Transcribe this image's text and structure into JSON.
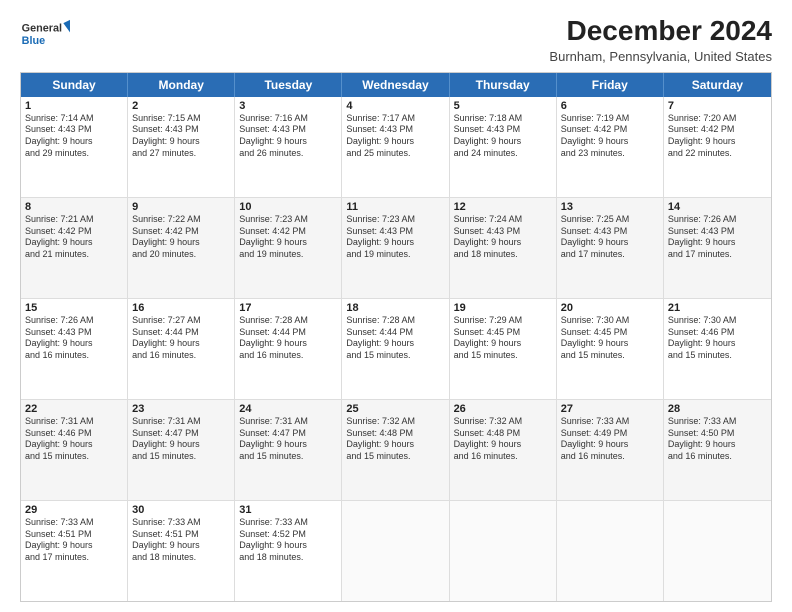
{
  "logo": {
    "line1": "General",
    "line2": "Blue"
  },
  "title": "December 2024",
  "subtitle": "Burnham, Pennsylvania, United States",
  "header_days": [
    "Sunday",
    "Monday",
    "Tuesday",
    "Wednesday",
    "Thursday",
    "Friday",
    "Saturday"
  ],
  "weeks": [
    [
      {
        "day": "1",
        "info": "Sunrise: 7:14 AM\nSunset: 4:43 PM\nDaylight: 9 hours\nand 29 minutes."
      },
      {
        "day": "2",
        "info": "Sunrise: 7:15 AM\nSunset: 4:43 PM\nDaylight: 9 hours\nand 27 minutes."
      },
      {
        "day": "3",
        "info": "Sunrise: 7:16 AM\nSunset: 4:43 PM\nDaylight: 9 hours\nand 26 minutes."
      },
      {
        "day": "4",
        "info": "Sunrise: 7:17 AM\nSunset: 4:43 PM\nDaylight: 9 hours\nand 25 minutes."
      },
      {
        "day": "5",
        "info": "Sunrise: 7:18 AM\nSunset: 4:43 PM\nDaylight: 9 hours\nand 24 minutes."
      },
      {
        "day": "6",
        "info": "Sunrise: 7:19 AM\nSunset: 4:42 PM\nDaylight: 9 hours\nand 23 minutes."
      },
      {
        "day": "7",
        "info": "Sunrise: 7:20 AM\nSunset: 4:42 PM\nDaylight: 9 hours\nand 22 minutes."
      }
    ],
    [
      {
        "day": "8",
        "info": "Sunrise: 7:21 AM\nSunset: 4:42 PM\nDaylight: 9 hours\nand 21 minutes."
      },
      {
        "day": "9",
        "info": "Sunrise: 7:22 AM\nSunset: 4:42 PM\nDaylight: 9 hours\nand 20 minutes."
      },
      {
        "day": "10",
        "info": "Sunrise: 7:23 AM\nSunset: 4:42 PM\nDaylight: 9 hours\nand 19 minutes."
      },
      {
        "day": "11",
        "info": "Sunrise: 7:23 AM\nSunset: 4:43 PM\nDaylight: 9 hours\nand 19 minutes."
      },
      {
        "day": "12",
        "info": "Sunrise: 7:24 AM\nSunset: 4:43 PM\nDaylight: 9 hours\nand 18 minutes."
      },
      {
        "day": "13",
        "info": "Sunrise: 7:25 AM\nSunset: 4:43 PM\nDaylight: 9 hours\nand 17 minutes."
      },
      {
        "day": "14",
        "info": "Sunrise: 7:26 AM\nSunset: 4:43 PM\nDaylight: 9 hours\nand 17 minutes."
      }
    ],
    [
      {
        "day": "15",
        "info": "Sunrise: 7:26 AM\nSunset: 4:43 PM\nDaylight: 9 hours\nand 16 minutes."
      },
      {
        "day": "16",
        "info": "Sunrise: 7:27 AM\nSunset: 4:44 PM\nDaylight: 9 hours\nand 16 minutes."
      },
      {
        "day": "17",
        "info": "Sunrise: 7:28 AM\nSunset: 4:44 PM\nDaylight: 9 hours\nand 16 minutes."
      },
      {
        "day": "18",
        "info": "Sunrise: 7:28 AM\nSunset: 4:44 PM\nDaylight: 9 hours\nand 15 minutes."
      },
      {
        "day": "19",
        "info": "Sunrise: 7:29 AM\nSunset: 4:45 PM\nDaylight: 9 hours\nand 15 minutes."
      },
      {
        "day": "20",
        "info": "Sunrise: 7:30 AM\nSunset: 4:45 PM\nDaylight: 9 hours\nand 15 minutes."
      },
      {
        "day": "21",
        "info": "Sunrise: 7:30 AM\nSunset: 4:46 PM\nDaylight: 9 hours\nand 15 minutes."
      }
    ],
    [
      {
        "day": "22",
        "info": "Sunrise: 7:31 AM\nSunset: 4:46 PM\nDaylight: 9 hours\nand 15 minutes."
      },
      {
        "day": "23",
        "info": "Sunrise: 7:31 AM\nSunset: 4:47 PM\nDaylight: 9 hours\nand 15 minutes."
      },
      {
        "day": "24",
        "info": "Sunrise: 7:31 AM\nSunset: 4:47 PM\nDaylight: 9 hours\nand 15 minutes."
      },
      {
        "day": "25",
        "info": "Sunrise: 7:32 AM\nSunset: 4:48 PM\nDaylight: 9 hours\nand 15 minutes."
      },
      {
        "day": "26",
        "info": "Sunrise: 7:32 AM\nSunset: 4:48 PM\nDaylight: 9 hours\nand 16 minutes."
      },
      {
        "day": "27",
        "info": "Sunrise: 7:33 AM\nSunset: 4:49 PM\nDaylight: 9 hours\nand 16 minutes."
      },
      {
        "day": "28",
        "info": "Sunrise: 7:33 AM\nSunset: 4:50 PM\nDaylight: 9 hours\nand 16 minutes."
      }
    ],
    [
      {
        "day": "29",
        "info": "Sunrise: 7:33 AM\nSunset: 4:51 PM\nDaylight: 9 hours\nand 17 minutes."
      },
      {
        "day": "30",
        "info": "Sunrise: 7:33 AM\nSunset: 4:51 PM\nDaylight: 9 hours\nand 18 minutes."
      },
      {
        "day": "31",
        "info": "Sunrise: 7:33 AM\nSunset: 4:52 PM\nDaylight: 9 hours\nand 18 minutes."
      },
      {
        "day": "",
        "info": ""
      },
      {
        "day": "",
        "info": ""
      },
      {
        "day": "",
        "info": ""
      },
      {
        "day": "",
        "info": ""
      }
    ]
  ]
}
